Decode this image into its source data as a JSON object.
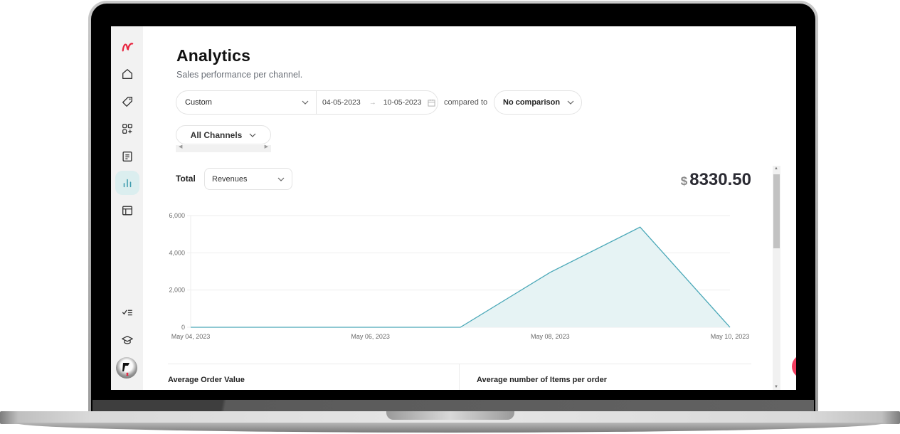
{
  "app": {
    "sidebar": {
      "items": [
        {
          "name": "logo",
          "icon": "brand-logo-icon"
        },
        {
          "name": "home",
          "icon": "home-icon"
        },
        {
          "name": "products",
          "icon": "tag-icon"
        },
        {
          "name": "apps",
          "icon": "apps-add-icon"
        },
        {
          "name": "orders",
          "icon": "document-icon"
        },
        {
          "name": "analytics",
          "icon": "bar-chart-icon",
          "active": true
        },
        {
          "name": "layout",
          "icon": "layout-icon"
        },
        {
          "name": "tasks",
          "icon": "checklist-icon"
        },
        {
          "name": "academy",
          "icon": "graduation-cap-icon"
        },
        {
          "name": "profile",
          "icon": "avatar"
        }
      ]
    },
    "header": {
      "title": "Analytics",
      "subtitle": "Sales performance per channel."
    },
    "filters": {
      "range_select": "Custom",
      "date_from": "04-05-2023",
      "date_arrow": "→",
      "date_to": "10-05-2023",
      "compared_label": "compared to",
      "comparison_select": "No comparison",
      "channels_select": "All Channels"
    },
    "summary": {
      "total_label": "Total",
      "metric_select": "Revenues",
      "currency": "$",
      "amount": "8330.50"
    },
    "kpis": {
      "left": "Average Order Value",
      "right": "Average number of Items per order"
    },
    "colors": {
      "accent": "#4aa8b8",
      "accent_fill": "#e6f3f4",
      "brand_red": "#e8253f",
      "chat": "#f23e60"
    }
  },
  "chart_data": {
    "type": "area",
    "title": "",
    "xlabel": "",
    "ylabel": "",
    "x": [
      "May 04, 2023",
      "May 05, 2023",
      "May 06, 2023",
      "May 07, 2023",
      "May 08, 2023",
      "May 09, 2023",
      "May 10, 2023"
    ],
    "x_tick_labels": [
      "May 04, 2023",
      "May 06, 2023",
      "May 08, 2023",
      "May 10, 2023"
    ],
    "series": [
      {
        "name": "Revenues",
        "values": [
          0,
          0,
          0,
          0,
          2950,
          5380,
          0
        ]
      }
    ],
    "ylim": [
      0,
      6000
    ],
    "y_ticks": [
      0,
      2000,
      4000,
      6000
    ],
    "y_tick_labels": [
      "0",
      "2,000",
      "4,000",
      "6,000"
    ],
    "grid": true,
    "legend": "none"
  }
}
